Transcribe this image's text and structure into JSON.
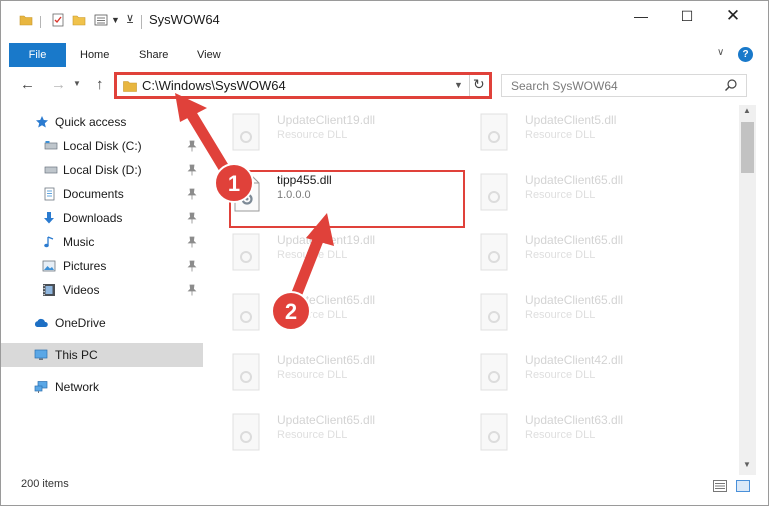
{
  "window": {
    "title": "SysWOW64",
    "controls": {
      "minimize": "—",
      "maximize": "☐",
      "close": "✕"
    }
  },
  "ribbon": {
    "tabs": [
      "File",
      "Home",
      "Share",
      "View"
    ],
    "help": "?"
  },
  "address_bar": {
    "path": "C:\\Windows\\SysWOW64"
  },
  "search": {
    "placeholder": "Search SysWOW64"
  },
  "navigation": {
    "items": [
      {
        "label": "Quick access",
        "icon": "star-icon"
      },
      {
        "label": "Local Disk (C:)",
        "icon": "drive-icon",
        "pinned": true
      },
      {
        "label": "Local Disk (D:)",
        "icon": "drive-icon",
        "pinned": true
      },
      {
        "label": "Documents",
        "icon": "documents-icon",
        "pinned": true
      },
      {
        "label": "Downloads",
        "icon": "download-icon",
        "pinned": true
      },
      {
        "label": "Music",
        "icon": "music-icon",
        "pinned": true
      },
      {
        "label": "Pictures",
        "icon": "pictures-icon",
        "pinned": true
      },
      {
        "label": "Videos",
        "icon": "videos-icon",
        "pinned": true
      },
      {
        "label": "OneDrive",
        "icon": "cloud-icon"
      },
      {
        "label": "This PC",
        "icon": "monitor-icon",
        "selected": true
      },
      {
        "label": "Network",
        "icon": "network-icon"
      }
    ]
  },
  "files": [
    {
      "name": "UpdateClient19.dll",
      "desc": "Resource DLL"
    },
    {
      "name": "UpdateClient5.dll",
      "desc": "Resource DLL"
    },
    {
      "name": "tipp455.dll",
      "desc": "1.0.0.0",
      "highlighted": true
    },
    {
      "name": "UpdateClient65.dll",
      "desc": "Resource DLL"
    },
    {
      "name": "UpdateClient19.dll",
      "desc": "Resource DLL"
    },
    {
      "name": "UpdateClient65.dll",
      "desc": "Resource DLL"
    },
    {
      "name": "UpdateClient65.dll",
      "desc": "Resource DLL"
    },
    {
      "name": "UpdateClient65.dll",
      "desc": "Resource DLL"
    },
    {
      "name": "UpdateClient65.dll",
      "desc": "Resource DLL"
    },
    {
      "name": "UpdateClient42.dll",
      "desc": "Resource DLL"
    },
    {
      "name": "UpdateClient65.dll",
      "desc": "Resource DLL"
    },
    {
      "name": "UpdateClient63.dll",
      "desc": "Resource DLL"
    }
  ],
  "status": {
    "items_count": "200 items"
  },
  "annotations": {
    "step1": "1",
    "step2": "2",
    "color": "#e0413a"
  },
  "colors": {
    "accent": "#1979ca",
    "selected_nav": "#d9d9d9",
    "highlight_border": "#e0413a"
  }
}
